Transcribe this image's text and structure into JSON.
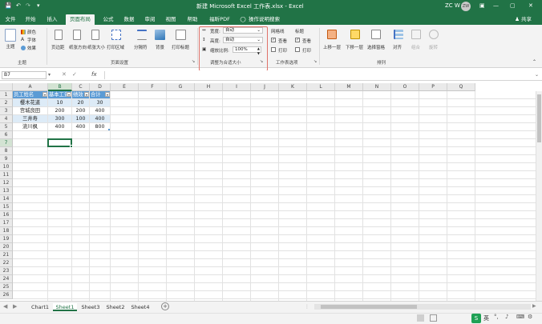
{
  "titlebar": {
    "save_icon": "save-icon",
    "title": "新建 Microsoft Excel 工作表.xlsx - Excel",
    "user": "ZC W",
    "avatar_text": "ZW"
  },
  "tabs": [
    "文件",
    "开始",
    "插入",
    "页面布局",
    "公式",
    "数据",
    "审阅",
    "视图",
    "帮助",
    "福昕PDF"
  ],
  "active_tab": "页面布局",
  "tell_me": "操作说明搜索",
  "share": "共享",
  "ribbon": {
    "themes": {
      "main": "主题",
      "colors": "颜色",
      "fonts": "字体",
      "effects": "效果",
      "group_label": "主题"
    },
    "page_setup": {
      "buttons": [
        "页边距",
        "纸张方向",
        "纸张大小",
        "打印区域",
        "分隔符",
        "背景",
        "打印标题"
      ],
      "group_label": "页面设置"
    },
    "scale_to_fit": {
      "width_label": "宽度:",
      "width_value": "自动",
      "height_label": "高度:",
      "height_value": "自动",
      "scale_label": "缩放比例:",
      "scale_value": "100%",
      "group_label": "调整为合适大小"
    },
    "sheet_options": {
      "gridlines": "网格线",
      "headings": "标题",
      "view": "查看",
      "print": "打印",
      "group_label": "工作表选项"
    },
    "arrange": {
      "buttons": [
        "上移一层",
        "下移一层",
        "选择窗格",
        "对齐",
        "组合",
        "旋转"
      ],
      "group_label": "排列"
    }
  },
  "formula_bar": {
    "name_box": "B7",
    "fx": "fx",
    "content": ""
  },
  "columns": [
    "A",
    "B",
    "C",
    "D",
    "E",
    "F",
    "G",
    "H",
    "I",
    "J",
    "K",
    "L",
    "M",
    "N",
    "O",
    "P",
    "Q"
  ],
  "rows": [
    "1",
    "2",
    "3",
    "4",
    "5",
    "6",
    "7",
    "8",
    "9",
    "10",
    "11",
    "12",
    "13",
    "14",
    "15",
    "16",
    "17",
    "18",
    "19",
    "20",
    "21",
    "22",
    "23",
    "24",
    "25",
    "26"
  ],
  "table": {
    "headers": [
      "员工姓名",
      "基本工资",
      "绩效",
      "合计"
    ],
    "rows": [
      [
        "樱木花道",
        "10",
        "20",
        "30"
      ],
      [
        "宫城良田",
        "200",
        "200",
        "400"
      ],
      [
        "三井寿",
        "300",
        "100",
        "400"
      ],
      [
        "流川枫",
        "400",
        "400",
        "800"
      ]
    ]
  },
  "sheet_tabs": [
    "Chart1",
    "Sheet1",
    "Sheet3",
    "Sheet2",
    "Sheet4"
  ],
  "active_sheet": "Sheet1",
  "status": {
    "ime": "英"
  },
  "colors": {
    "excel_green": "#217346",
    "table_header": "#5b9bd5",
    "table_band": "#ddebf7",
    "highlight": "#e0736a"
  }
}
